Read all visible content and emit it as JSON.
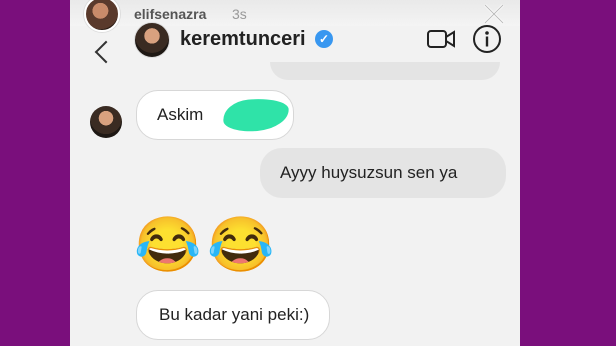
{
  "story": {
    "username": "elifsenazra",
    "time": "3s"
  },
  "chat_header": {
    "name": "keremtunceri",
    "verified_icon": "verified-badge-icon",
    "video_icon": "video-camera-icon",
    "info_icon": "info-icon"
  },
  "messages": [
    {
      "sender": "other",
      "text": "Askim"
    },
    {
      "sender": "me",
      "text": "Ayyy  huysuzsun sen ya"
    },
    {
      "sender": "other",
      "text": "😂😂"
    },
    {
      "sender": "other",
      "text": "Bu kadar yani peki:)"
    }
  ],
  "colors": {
    "background": "#7a0f7c",
    "verified": "#3897f0",
    "redaction": "#2fe3a8"
  }
}
